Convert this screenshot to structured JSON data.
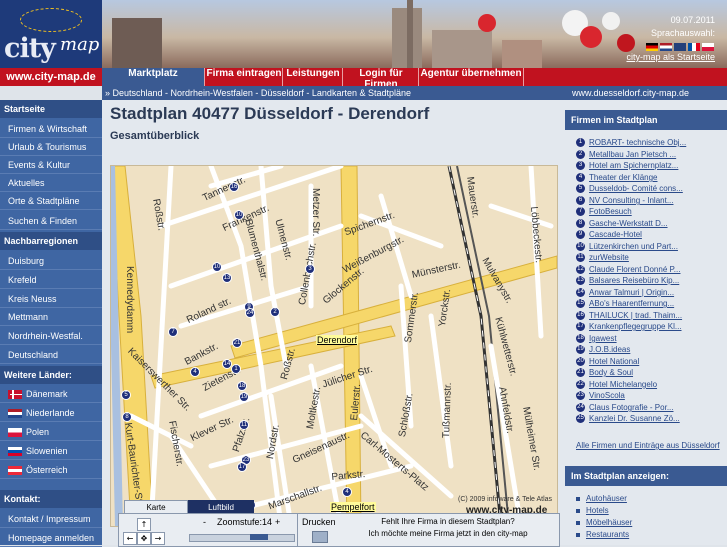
{
  "header": {
    "logo_city": "city",
    "logo_map": "map",
    "logo_url": "www.city-map.de",
    "date": "09.07.2011",
    "language_label": "Sprachauswahl:",
    "homepage_link": "city-map als Startseite"
  },
  "nav": {
    "items": [
      "Marktplatz",
      "Firma eintragen",
      "Leistungen",
      "Login für Firmen",
      "Agentur übernehmen"
    ]
  },
  "breadcrumb": {
    "text": "» Deutschland - Nordrhein-Westfalen - Düsseldorf - Landkarten & Stadtpläne",
    "site": "www.duesseldorf.city-map.de"
  },
  "sidebar": {
    "heading_start": "Startseite",
    "items_start": [
      "Firmen & Wirtschaft",
      "Urlaub & Tourismus",
      "Events & Kultur",
      "Aktuelles",
      "Orte & Stadtpläne",
      "Suchen & Finden"
    ],
    "heading_neighbors": "Nachbarregionen",
    "items_neighbors": [
      "Duisburg",
      "Krefeld",
      "Kreis Neuss",
      "Mettmann",
      "Nordrhein-Westfal.",
      "Deutschland"
    ],
    "heading_countries": "Weitere Länder:",
    "items_countries": [
      "Dänemark",
      "Niederlande",
      "Polen",
      "Slowenien",
      "Österreich"
    ],
    "heading_contact": "Kontakt:",
    "items_contact": [
      "Kontakt / Impressum",
      "Homepage anmelden"
    ]
  },
  "main": {
    "title": "Stadtplan 40477 Düsseldorf - Derendorf",
    "subtitle": "Gesamtüberblick"
  },
  "map": {
    "streets": [
      "Tannenstr.",
      "Roßstr.",
      "Frankenstr.",
      "Blumenthalstr.",
      "Ulmenstr.",
      "Metzer Str.",
      "Spichernstr.",
      "Weißenburgstr.",
      "Münsterstr.",
      "Mauerstr.",
      "Löbbeckestr.",
      "Kennedydamm",
      "Roland str.",
      "Collenbachstr.",
      "Glockenstr.",
      "Yorckstr.",
      "Sommerstr.",
      "Mulvanystr.",
      "Kühlwetterstr.",
      "Kaiserswerther Str.",
      "Bankstr.",
      "Zietenstr.",
      "Jülicher Str.",
      "Roßstr.",
      "Klever Str.",
      "Pfalzstr.",
      "Nordstr.",
      "Moltkestr.",
      "Eulerstr.",
      "Schloßstr.",
      "Tußmannstr.",
      "Ahnfeldstr.",
      "Mülheimer Str.",
      "Kurt-Baurichter-Str.",
      "Fischerstr.",
      "Gneisenaustr.",
      "Carl-Mosterts-Platz",
      "Parkstr.",
      "Marschallstr."
    ],
    "district": "Derendorf",
    "district2": "Pempelfort",
    "copyright": "(C) 2009 infoware & Tele Atlas",
    "url": "www.city-map.de"
  },
  "controls": {
    "tab_map": "Karte",
    "tab_aerial": "Luftbild",
    "zoom_label": "Zoomstufe:",
    "zoom_value": "14",
    "minus": "-",
    "plus": "+",
    "print": "Drucken",
    "missing_line1": "Fehlt Ihre Firma in diesem Stadtplan?",
    "missing_line2": "Ich möchte meine Firma jetzt in den city-map"
  },
  "right": {
    "heading_firms": "Firmen im Stadtplan",
    "firms": [
      "ROBART- technische Obj...",
      "Metallbau Jan Pietsch ...",
      "Hotel am Spichernplatz...",
      "Theater der Klänge",
      "Dusseldob- Comité cons...",
      "NV Consulting - Inlant...",
      "FotoBesuch",
      "Gasche-Werkstatt D...",
      "Cascade-Hotel",
      "Lützenkirchen und Part...",
      "zurWebsite",
      "Claude Florent Donné P...",
      "Balsares Reisebüro Kip...",
      "Anwar Talmuri | Origin...",
      "ABo's Haarentfernung...",
      "THAILUCK | trad. Thaim...",
      "Krankenpflegegruppe Kl...",
      "Igawest",
      "J.O.B.ideas",
      "Hotel National",
      "Body & Soul",
      "Hotel Michelangelo",
      "VinoScola",
      "Claus Fotografie - Por...",
      "Kanzlei Dr. Susanne Zö..."
    ],
    "all_link": "Alle Firmen und Einträge aus Düsseldorf",
    "heading_show": "Im Stadtplan anzeigen:",
    "categories": [
      "Autohäuser",
      "Hotels",
      "Möbelhäuser",
      "Restaurants"
    ]
  },
  "colors": {
    "nav_red": "#c1121f",
    "sidebar_blue": "#3f66a3",
    "header_blue": "#3a5a92",
    "map_bg": "#efe1c4",
    "road_yellow": "#f6d76a",
    "marker": "#1f2f7a"
  }
}
